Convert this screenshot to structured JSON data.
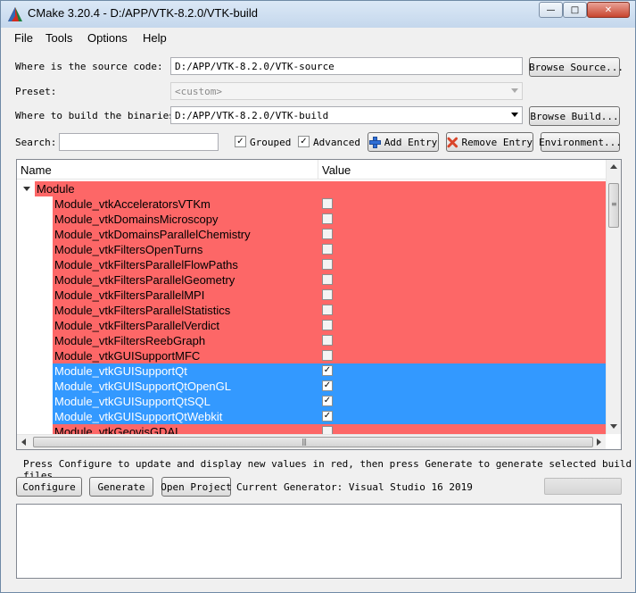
{
  "window": {
    "title": "CMake 3.20.4 - D:/APP/VTK-8.2.0/VTK-build",
    "minimize": "—",
    "maximize": "□",
    "close": "✕"
  },
  "menu": [
    "File",
    "Tools",
    "Options",
    "Help"
  ],
  "source": {
    "label": "Where is the source code:",
    "value": "D:/APP/VTK-8.2.0/VTK-source",
    "browse": "Browse Source..."
  },
  "preset": {
    "label": "Preset:",
    "value": "<custom>"
  },
  "build": {
    "label": "Where to build the binaries:",
    "value": "D:/APP/VTK-8.2.0/VTK-build",
    "browse": "Browse Build..."
  },
  "search": {
    "label": "Search:",
    "value": ""
  },
  "options": {
    "grouped": {
      "label": "Grouped",
      "checked": true
    },
    "advanced": {
      "label": "Advanced",
      "checked": true
    }
  },
  "buttons": {
    "add_entry": "Add Entry",
    "remove_entry": "Remove Entry",
    "environment": "Environment...",
    "configure": "Configure",
    "generate": "Generate",
    "open_project": "Open Project"
  },
  "table": {
    "headers": {
      "name": "Name",
      "value": "Value"
    },
    "group": "Module",
    "rows": [
      {
        "name": "Module_vtkAcceleratorsVTKm",
        "checked": false,
        "state": "red"
      },
      {
        "name": "Module_vtkDomainsMicroscopy",
        "checked": false,
        "state": "red"
      },
      {
        "name": "Module_vtkDomainsParallelChemistry",
        "checked": false,
        "state": "red"
      },
      {
        "name": "Module_vtkFiltersOpenTurns",
        "checked": false,
        "state": "red"
      },
      {
        "name": "Module_vtkFiltersParallelFlowPaths",
        "checked": false,
        "state": "red"
      },
      {
        "name": "Module_vtkFiltersParallelGeometry",
        "checked": false,
        "state": "red"
      },
      {
        "name": "Module_vtkFiltersParallelMPI",
        "checked": false,
        "state": "red"
      },
      {
        "name": "Module_vtkFiltersParallelStatistics",
        "checked": false,
        "state": "red"
      },
      {
        "name": "Module_vtkFiltersParallelVerdict",
        "checked": false,
        "state": "red"
      },
      {
        "name": "Module_vtkFiltersReebGraph",
        "checked": false,
        "state": "red"
      },
      {
        "name": "Module_vtkGUISupportMFC",
        "checked": false,
        "state": "red"
      },
      {
        "name": "Module_vtkGUISupportQt",
        "checked": true,
        "state": "blue"
      },
      {
        "name": "Module_vtkGUISupportQtOpenGL",
        "checked": true,
        "state": "blue"
      },
      {
        "name": "Module_vtkGUISupportQtSQL",
        "checked": true,
        "state": "blue"
      },
      {
        "name": "Module_vtkGUISupportQtWebkit",
        "checked": true,
        "state": "blue"
      },
      {
        "name": "Module_vtkGeovisGDAL",
        "checked": false,
        "state": "red"
      }
    ]
  },
  "hint": "Press Configure to update and display new values in red, then press Generate to generate selected build files.",
  "generator": "Current Generator: Visual Studio 16 2019",
  "colors": {
    "new_value_red": "#fd6767",
    "selected_blue": "#3399ff"
  },
  "icons": {
    "app": "cmake-triangle-icon",
    "add": "plus-icon",
    "remove": "x-icon"
  }
}
